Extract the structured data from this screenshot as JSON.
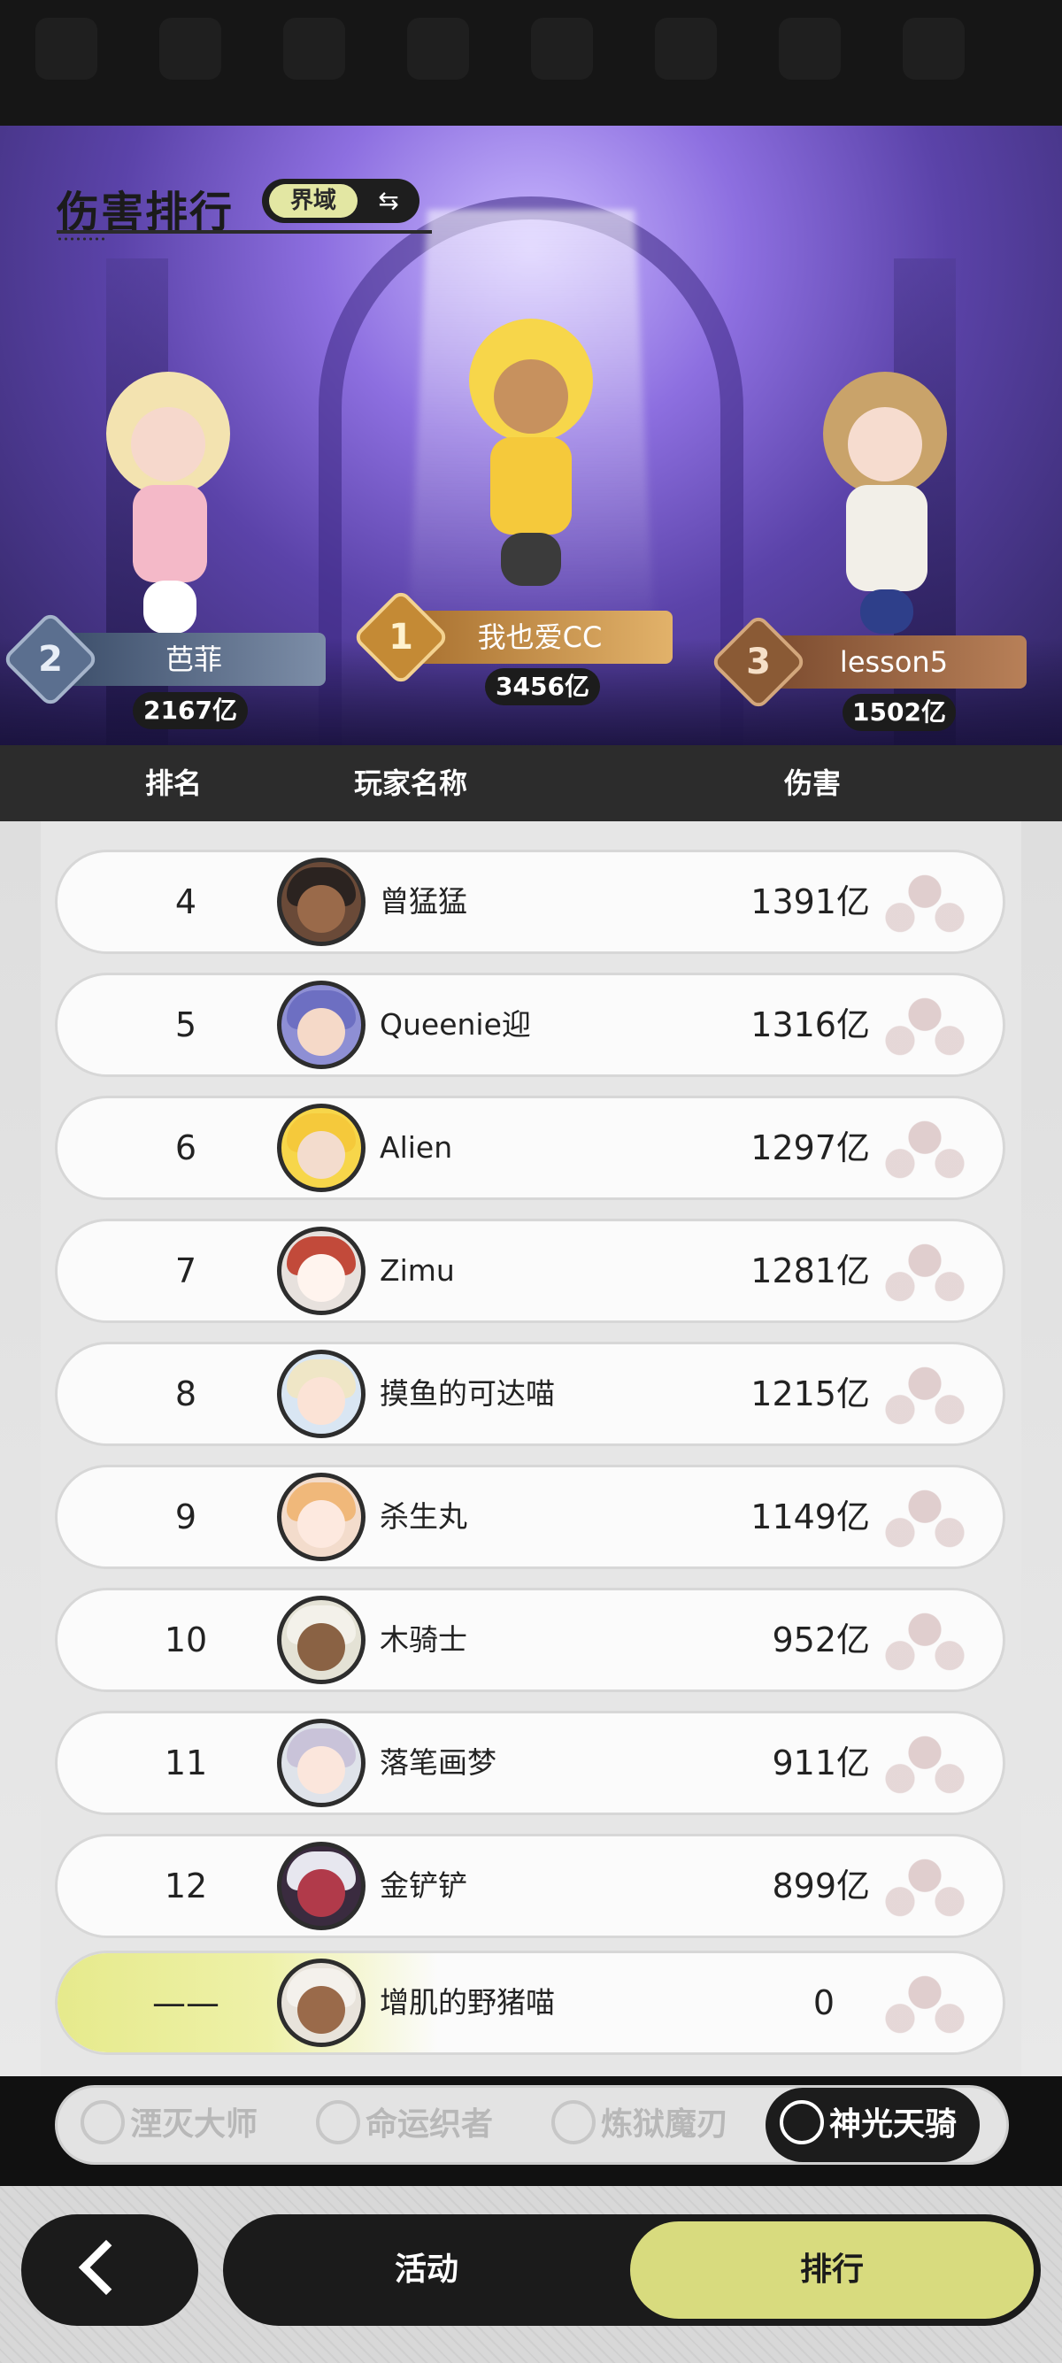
{
  "header": {
    "title": "伤害排行",
    "realm_label": "界域",
    "swap_icon": "swap-icon"
  },
  "podium": [
    {
      "rank": "2",
      "name": "芭菲",
      "score": "2167亿"
    },
    {
      "rank": "1",
      "name": "我也爱CC",
      "score": "3456亿"
    },
    {
      "rank": "3",
      "name": "lesson5",
      "score": "1502亿"
    }
  ],
  "table": {
    "headers": {
      "rank": "排名",
      "player": "玩家名称",
      "damage": "伤害"
    },
    "rows": [
      {
        "rank": "4",
        "name": "曾猛猛",
        "damage": "1391亿"
      },
      {
        "rank": "5",
        "name": "Queenie迎",
        "damage": "1316亿"
      },
      {
        "rank": "6",
        "name": "Alien",
        "damage": "1297亿"
      },
      {
        "rank": "7",
        "name": "Zimu",
        "damage": "1281亿"
      },
      {
        "rank": "8",
        "name": "摸鱼的可达喵",
        "damage": "1215亿"
      },
      {
        "rank": "9",
        "name": "杀生丸",
        "damage": "1149亿"
      },
      {
        "rank": "10",
        "name": "木骑士",
        "damage": "952亿"
      },
      {
        "rank": "11",
        "name": "落笔画梦",
        "damage": "911亿"
      },
      {
        "rank": "12",
        "name": "金铲铲",
        "damage": "899亿"
      }
    ],
    "self_row": {
      "rank": "——",
      "name": "增肌的野猪喵",
      "damage": "0"
    }
  },
  "category_tabs": [
    {
      "label": "湮灭大师",
      "active": false
    },
    {
      "label": "命运织者",
      "active": false
    },
    {
      "label": "炼狱魔刃",
      "active": false
    },
    {
      "label": "神光天骑",
      "active": true
    }
  ],
  "bottom_nav": {
    "back_icon": "chevron-left-icon",
    "activity_label": "活动",
    "ranking_label": "排行"
  },
  "colors": {
    "accent_yellow": "#d8db7e",
    "dark": "#1b1b1b",
    "hero_purple": "#8d6fe0"
  }
}
